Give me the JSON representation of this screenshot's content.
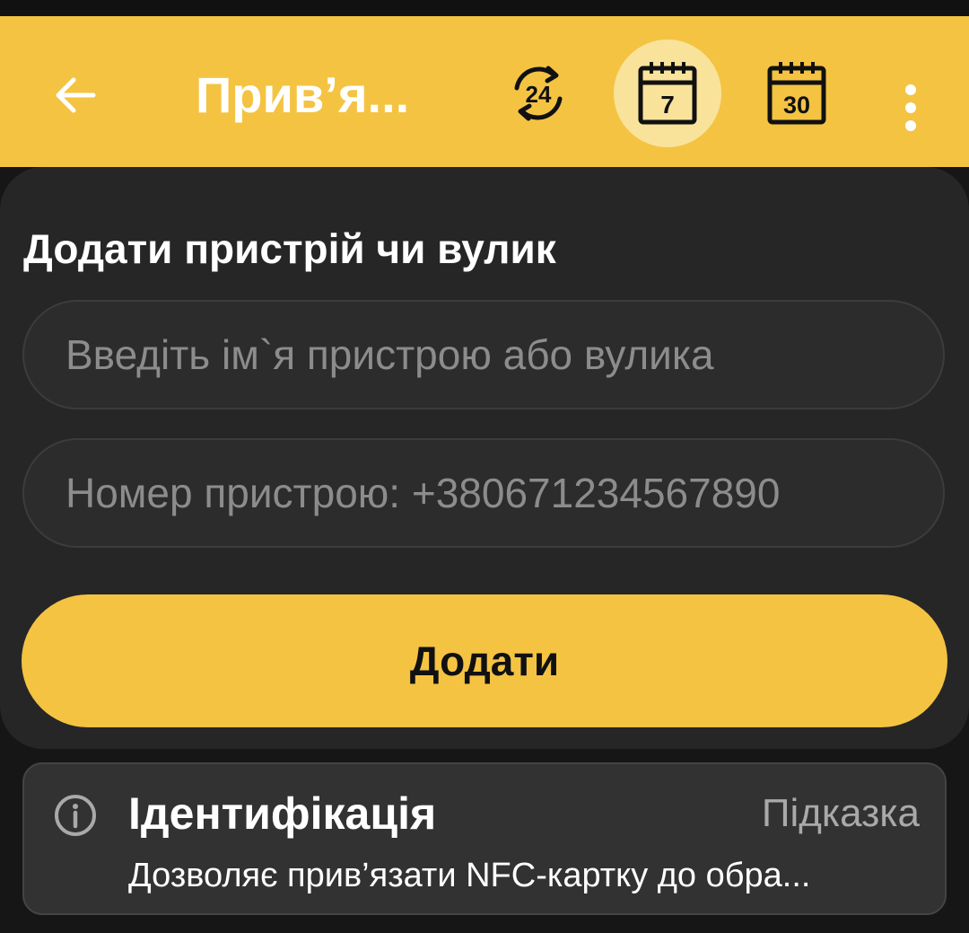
{
  "toolbar": {
    "title": "Прив’я...",
    "back_icon": "arrow-left-icon",
    "period_24_label": "24",
    "period_7_label": "7",
    "period_30_label": "30",
    "menu_icon": "more-vertical-icon"
  },
  "form": {
    "title": "Додати пристрій чи вулик",
    "name_placeholder": "Введіть ім`я пристрою або вулика",
    "number_placeholder": "Номер пристрою: +380671234567890",
    "add_label": "Додати"
  },
  "hint": {
    "icon": "info-icon",
    "title": "Ідентифікація",
    "link_label": "Підказка",
    "description": "Дозволяє прив’язати NFC-картку до обра..."
  },
  "colors": {
    "accent": "#F4C342",
    "active_icon_bg": "#F9E39B",
    "card_bg": "#262626",
    "page_bg": "#161616"
  }
}
